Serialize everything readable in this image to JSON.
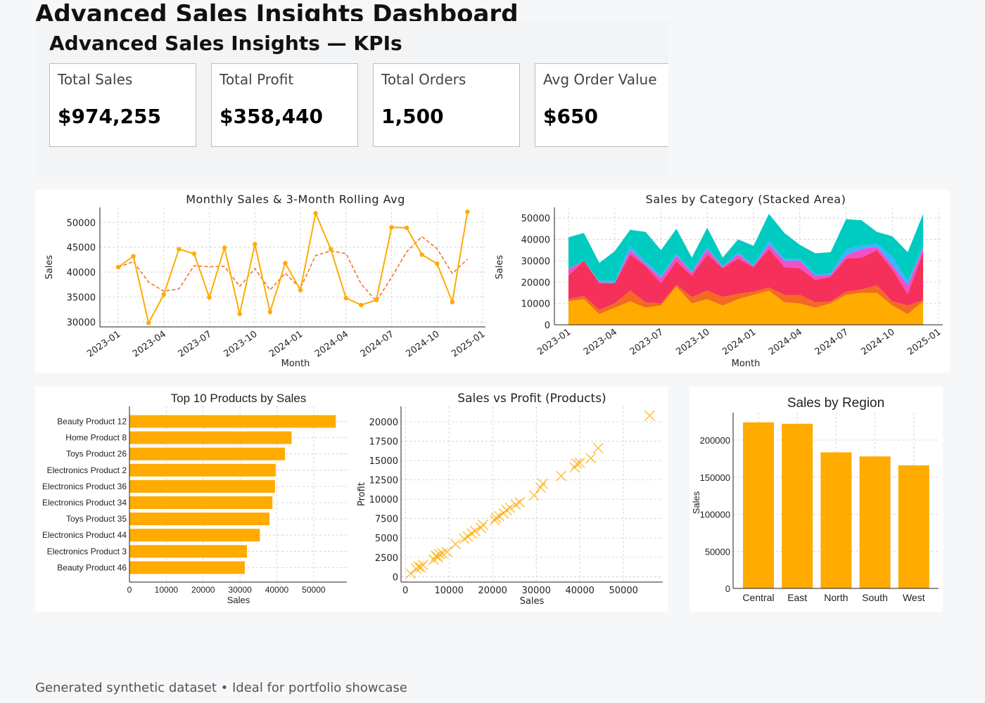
{
  "page": {
    "title": "Advanced Sales Insights Dashboard",
    "footer": "Generated synthetic dataset • Ideal for portfolio showcase"
  },
  "kpis": {
    "title": "Advanced Sales Insights — KPIs",
    "cards": [
      {
        "label": "Total Sales",
        "value": "$974,255"
      },
      {
        "label": "Total Profit",
        "value": "$358,440"
      },
      {
        "label": "Total Orders",
        "value": "1,500"
      },
      {
        "label": "Avg Order Value",
        "value": "$650"
      }
    ]
  },
  "colors": {
    "primary": "#ffab00",
    "rolling": "#f26b21",
    "grid": "#cccccc",
    "cat1": "#ffab00",
    "cat2": "#f26b21",
    "cat3": "#f5305a",
    "cat4": "#f050c8",
    "cat5": "#3cb4ff",
    "cat6": "#00cbc0"
  },
  "chart_data": [
    {
      "type": "line",
      "title": "Monthly Sales & 3-Month Rolling Avg",
      "xlabel": "Month",
      "ylabel": "Sales",
      "x": [
        "2023-01",
        "2023-02",
        "2023-03",
        "2023-04",
        "2023-05",
        "2023-06",
        "2023-07",
        "2023-08",
        "2023-09",
        "2023-10",
        "2023-11",
        "2023-12",
        "2024-01",
        "2024-02",
        "2024-03",
        "2024-04",
        "2024-05",
        "2024-06",
        "2024-07",
        "2024-08",
        "2024-09",
        "2024-10",
        "2024-11",
        "2024-12"
      ],
      "xticks": [
        "2023-01",
        "2023-04",
        "2023-07",
        "2023-10",
        "2024-01",
        "2024-04",
        "2024-07",
        "2024-10",
        "2025-01"
      ],
      "yticks": [
        30000,
        35000,
        40000,
        45000,
        50000
      ],
      "ylim": [
        29000,
        53000
      ],
      "grid": true,
      "series": [
        {
          "values": [
            41000,
            43200,
            29800,
            35500,
            44600,
            43700,
            34900,
            44900,
            31600,
            45600,
            32000,
            41800,
            36400,
            51800,
            44600,
            34800,
            33400,
            34400,
            49000,
            48900,
            43500,
            41700,
            34000,
            52100
          ]
        },
        {
          "values": [
            41000,
            42100,
            38000,
            36166,
            36633,
            41266,
            41066,
            41166,
            37133,
            40700,
            36400,
            39800,
            36733,
            43333,
            44266,
            43733,
            37600,
            34200,
            38933,
            44100,
            47133,
            44700,
            39733,
            42600
          ]
        }
      ]
    },
    {
      "type": "area",
      "title": "Sales by Category (Stacked Area)",
      "xlabel": "Month",
      "ylabel": "Sales",
      "x": [
        "2023-01",
        "2023-02",
        "2023-03",
        "2023-04",
        "2023-05",
        "2023-06",
        "2023-07",
        "2023-08",
        "2023-09",
        "2023-10",
        "2023-11",
        "2023-12",
        "2024-01",
        "2024-02",
        "2024-03",
        "2024-04",
        "2024-05",
        "2024-06",
        "2024-07",
        "2024-08",
        "2024-09",
        "2024-10",
        "2024-11",
        "2024-12"
      ],
      "xticks": [
        "2023-01",
        "2023-04",
        "2023-07",
        "2023-10",
        "2024-01",
        "2024-04",
        "2024-07",
        "2024-10",
        "2025-01"
      ],
      "yticks": [
        0,
        10000,
        20000,
        30000,
        40000,
        50000
      ],
      "ylim": [
        0,
        55000
      ],
      "grid": true,
      "series": [
        {
          "values": [
            11000,
            12000,
            5000,
            8000,
            11000,
            8000,
            9000,
            18000,
            10000,
            12000,
            9000,
            12000,
            14000,
            16000,
            10500,
            10000,
            8000,
            10000,
            14000,
            15000,
            15000,
            9000,
            5000,
            11000
          ]
        },
        {
          "values": [
            1000,
            1500,
            2000,
            2000,
            5000,
            2500,
            1000,
            800,
            3000,
            4000,
            4000,
            2500,
            1500,
            1500,
            3500,
            4000,
            2500,
            1000,
            1500,
            1500,
            3500,
            2000,
            4000,
            500
          ]
        },
        {
          "values": [
            11000,
            16500,
            12500,
            9500,
            17000,
            17000,
            9500,
            11000,
            10000,
            17000,
            13500,
            16500,
            11500,
            18000,
            13000,
            12500,
            10500,
            11500,
            15500,
            15000,
            16500,
            15000,
            5500,
            22500
          ]
        },
        {
          "values": [
            3000,
            0,
            500,
            0,
            2000,
            1000,
            2500,
            2500,
            1500,
            2500,
            500,
            2000,
            500,
            2000,
            3000,
            3500,
            2000,
            1000,
            1500,
            4000,
            1500,
            2000,
            4000,
            2000
          ]
        },
        {
          "values": [
            200,
            0,
            500,
            1000,
            2000,
            1000,
            1000,
            1000,
            500,
            1000,
            500,
            1000,
            500,
            2000,
            1000,
            1000,
            500,
            500,
            3000,
            1500,
            1500,
            4000,
            2000,
            1000
          ]
        },
        {
          "values": [
            14800,
            13000,
            8500,
            14000,
            7500,
            14000,
            12000,
            11700,
            6500,
            9000,
            4000,
            6000,
            9000,
            12500,
            12000,
            6500,
            10000,
            10000,
            14000,
            12000,
            5500,
            9500,
            13500,
            15000
          ]
        }
      ]
    },
    {
      "type": "bar",
      "orientation": "horizontal",
      "title": "Top 10 Products by Sales",
      "xlabel": "Sales",
      "categories": [
        "Beauty Product 12",
        "Home Product 8",
        "Toys Product 26",
        "Electronics Product 2",
        "Electronics Product 36",
        "Electronics Product 34",
        "Toys Product 35",
        "Electronics Product 44",
        "Electronics Product 3",
        "Beauty Product 46"
      ],
      "values": [
        56000,
        44000,
        42200,
        39700,
        39500,
        38800,
        38000,
        35400,
        31900,
        31300
      ],
      "xticks": [
        0,
        10000,
        20000,
        30000,
        40000,
        50000
      ],
      "xlim": [
        0,
        59000
      ],
      "grid": true
    },
    {
      "type": "scatter",
      "title": "Sales vs Profit (Products)",
      "xlabel": "Sales",
      "ylabel": "Profit",
      "xticks": [
        0,
        10000,
        20000,
        30000,
        40000,
        50000
      ],
      "yticks": [
        0,
        2500,
        5000,
        7500,
        10000,
        12500,
        15000,
        17500,
        20000
      ],
      "xlim": [
        -1000,
        59000
      ],
      "ylim": [
        -700,
        22000
      ],
      "grid": true,
      "points": [
        [
          56000,
          20800
        ],
        [
          44200,
          16600
        ],
        [
          42500,
          15300
        ],
        [
          40000,
          14700
        ],
        [
          39300,
          14600
        ],
        [
          38800,
          14100
        ],
        [
          35700,
          13000
        ],
        [
          31500,
          12000
        ],
        [
          31000,
          11500
        ],
        [
          29500,
          10500
        ],
        [
          26200,
          9600
        ],
        [
          25300,
          9300
        ],
        [
          24000,
          8900
        ],
        [
          23200,
          8600
        ],
        [
          22500,
          8200
        ],
        [
          21500,
          7800
        ],
        [
          20800,
          7600
        ],
        [
          20500,
          7300
        ],
        [
          17800,
          6700
        ],
        [
          17300,
          6300
        ],
        [
          16000,
          5900
        ],
        [
          15200,
          5600
        ],
        [
          14300,
          5200
        ],
        [
          13500,
          4900
        ],
        [
          11500,
          4200
        ],
        [
          9500,
          3200
        ],
        [
          8500,
          3000
        ],
        [
          7800,
          2900
        ],
        [
          7500,
          2500
        ],
        [
          7000,
          2700
        ],
        [
          6500,
          2200
        ],
        [
          4000,
          1500
        ],
        [
          3500,
          1200
        ],
        [
          3000,
          1300
        ],
        [
          2500,
          1000
        ],
        [
          1200,
          400
        ]
      ]
    },
    {
      "type": "bar",
      "title": "Sales by Region",
      "ylabel": "Sales",
      "categories": [
        "Central",
        "East",
        "North",
        "South",
        "West"
      ],
      "values": [
        224000,
        222000,
        183500,
        178000,
        166000
      ],
      "yticks": [
        0,
        50000,
        100000,
        150000,
        200000
      ],
      "ylim": [
        0,
        237000
      ],
      "grid": true
    }
  ]
}
